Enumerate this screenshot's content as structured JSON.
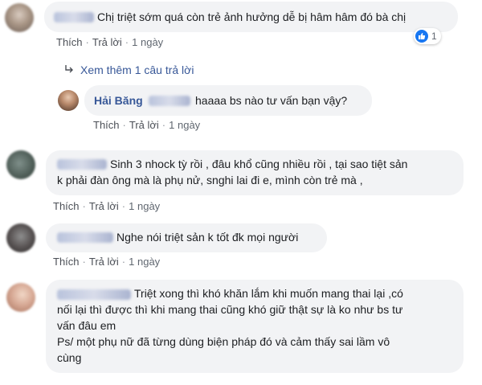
{
  "comments": [
    {
      "text": "Chị triệt sớm quá còn trẻ ảnh hưởng dễ bị hâm hâm đó bà chị",
      "actions": {
        "like": "Thích",
        "reply": "Trả lời",
        "time": "1 ngày"
      },
      "reactions": {
        "count": "1",
        "icon": "thumbs-up-icon"
      },
      "view_more": "Xem thêm 1 câu trả lời",
      "reply": {
        "author": "Hải Băng",
        "text": "haaaa bs nào tư vấn bạn vậy?",
        "actions": {
          "like": "Thích",
          "reply": "Trả lời",
          "time": "1 ngày"
        }
      }
    },
    {
      "lines": [
        "Sinh 3 nhock tỳ rồi , đâu khổ cũng nhiều rồi , tại sao tiệt sản",
        "k phải đàn ông mà là phụ nử, snghi lai đi e, mình còn trẻ mà ,"
      ],
      "actions": {
        "like": "Thích",
        "reply": "Trả lời",
        "time": "1 ngày"
      }
    },
    {
      "text": "Nghe nói triệt sản k tốt đk mọi người",
      "actions": {
        "like": "Thích",
        "reply": "Trả lời",
        "time": "1 ngày"
      }
    },
    {
      "lines": [
        "Triệt xong thì khó khăn lắm khi muốn mang thai lại ,có",
        "nối lại thì được thì khi mang thai cũng khó giữ thật sự là ko như bs tư",
        "vấn đâu em",
        "Ps/ một phụ nữ đã từng dùng biện pháp đó và cảm thấy sai lầm vô",
        "cùng"
      ]
    }
  ],
  "colors": {
    "name_link": "#385898",
    "bubble_bg": "#f2f3f5",
    "like_blue": "#1877f2",
    "meta_text": "#606770"
  }
}
